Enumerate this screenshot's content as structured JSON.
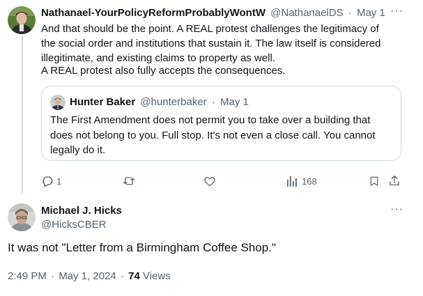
{
  "tweet": {
    "author_name": "Nathanael-YourPolicyReformProbablyWontW",
    "author_handle": "@NathanaelDS",
    "separator": "·",
    "date": "May 1",
    "more": "···",
    "text_lines": [
      "And that should be the point. A REAL protest challenges the legitimacy of",
      "the social order and institutions that sustain it. The law itself is considered",
      "illegitimate, and existing claims to property as well.",
      "A REAL protest also fully accepts the consequences."
    ],
    "quote": {
      "author_name": "Hunter Baker",
      "author_handle": "@hunterbaker",
      "separator": "·",
      "date": "May 1",
      "text_lines": [
        "The First Amendment does not permit you to take over a building that",
        "does not belong to you. Full stop. It's not even a close call. You cannot",
        "legally do it."
      ]
    },
    "actions": {
      "reply_icon": "reply-icon",
      "reply_count": "1",
      "retweet_icon": "retweet-icon",
      "like_icon": "heart-icon",
      "views_icon": "views-icon",
      "views_count": "168",
      "bookmark_icon": "bookmark-icon",
      "share_icon": "share-icon"
    }
  },
  "reply": {
    "author_name": "Michael J. Hicks",
    "author_handle": "@HicksCBER",
    "more": "···",
    "text": "It was not \"Letter from a Birmingham Coffee Shop.\"",
    "time": "2:49 PM",
    "separator": "·",
    "date": "May 1, 2024",
    "separator2": "·",
    "views_count": "74",
    "views_label": "Views"
  },
  "colors": {
    "text": "#0f1419",
    "muted": "#536471",
    "border": "#cfd9de"
  }
}
